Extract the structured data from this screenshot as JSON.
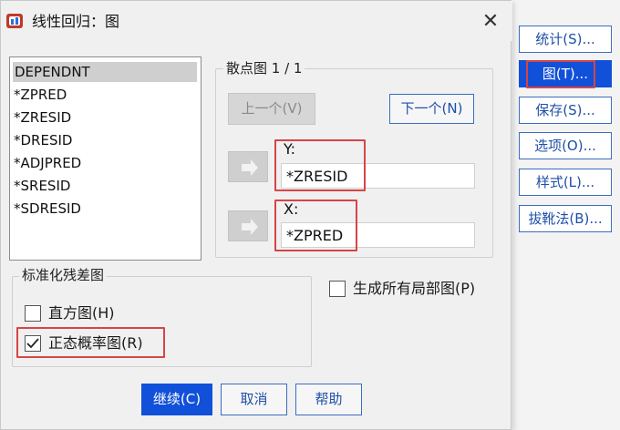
{
  "window": {
    "title": "线性回归：图",
    "close_glyph": "✕"
  },
  "variables": [
    "DEPENDNT",
    "*ZPRED",
    "*ZRESID",
    "*DRESID",
    "*ADJPRED",
    "*SRESID",
    "*SDRESID"
  ],
  "scatter": {
    "group_label": "散点图 1 / 1",
    "prev_label": "上一个(V)",
    "next_label": "下一个(N)",
    "y_label": "Y:",
    "y_value": "*ZRESID",
    "x_label": "X:",
    "x_value": "*ZPRED"
  },
  "residual_group": {
    "label": "标准化残差图",
    "histogram": {
      "label": "直方图(H)",
      "checked": false
    },
    "normal_prob": {
      "label": "正态概率图(R)",
      "checked": true
    }
  },
  "partial_plots": {
    "label": "生成所有局部图(P)",
    "checked": false
  },
  "footer": {
    "continue_label": "继续(C)",
    "cancel_label": "取消",
    "help_label": "帮助"
  },
  "side_buttons": [
    {
      "label": "统计(S)...",
      "active": false
    },
    {
      "label": "图(T)...",
      "active": true
    },
    {
      "label": "保存(S)...",
      "active": false
    },
    {
      "label": "选项(O)...",
      "active": false
    },
    {
      "label": "样式(L)...",
      "active": false
    },
    {
      "label": "拔靴法(B)...",
      "active": false
    }
  ],
  "colors": {
    "accent": "#1150d9",
    "highlight_box": "#d64545",
    "button_text": "#1f4fa8"
  },
  "icons": [
    "app-icon",
    "close-icon",
    "arrow-right-icon",
    "checkmark-icon"
  ]
}
